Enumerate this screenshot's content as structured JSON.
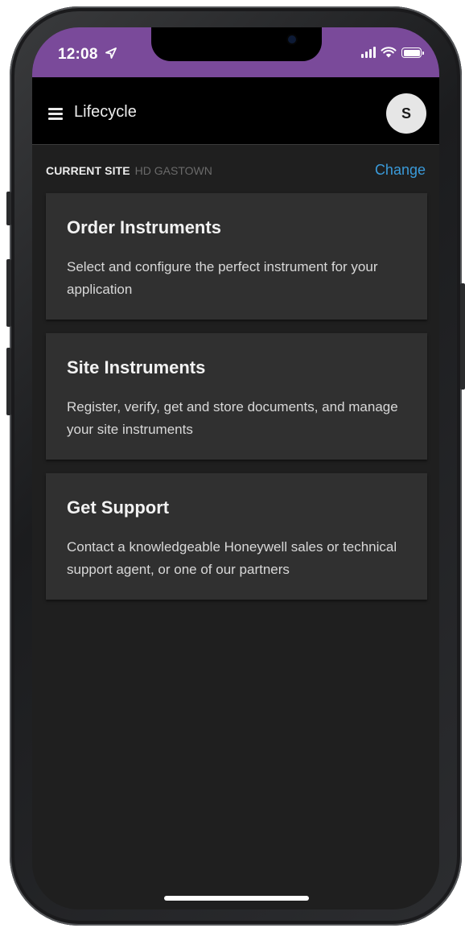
{
  "status_bar": {
    "time": "12:08",
    "location_icon": "location-arrow-icon",
    "signal_icon": "cellular-signal-icon",
    "wifi_icon": "wifi-icon",
    "battery_icon": "battery-icon",
    "background_color": "#7a4a9a"
  },
  "header": {
    "menu_icon": "hamburger-menu-icon",
    "title": "Lifecycle",
    "avatar_initial": "S"
  },
  "site": {
    "label": "CURRENT SITE",
    "name": "HD GASTOWN",
    "change_label": "Change",
    "link_color": "#3a9ad9"
  },
  "cards": [
    {
      "title": "Order Instruments",
      "description": "Select and configure the perfect instrument for your application"
    },
    {
      "title": "Site Instruments",
      "description": "Register, verify, get and store documents, and manage your site instruments"
    },
    {
      "title": "Get Support",
      "description": "Contact a knowledgeable Honeywell sales or technical support agent, or one of our partners"
    }
  ]
}
